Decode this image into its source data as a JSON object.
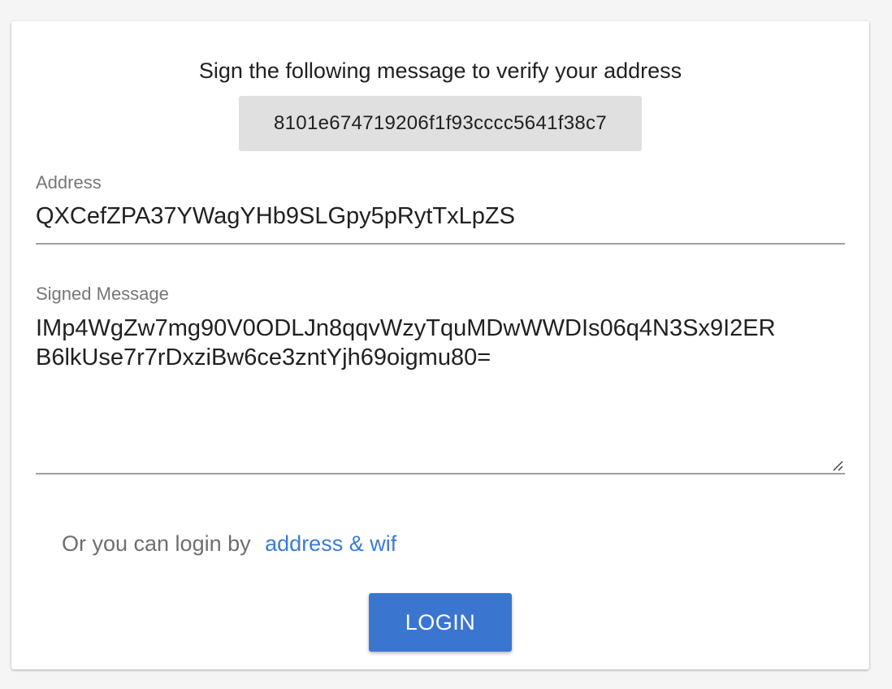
{
  "instruction": "Sign the following message to verify your address",
  "message": "8101e674719206f1f93cccc5641f38c7",
  "address": {
    "label": "Address",
    "value": "QXCefZPA37YWagYHb9SLGpy5pRytTxLpZS"
  },
  "signed_message": {
    "label": "Signed Message",
    "line1": "IMp4WgZw7mg90V0ODLJn8qqvWzyTquMDwWWDIs06q4N3Sx9I2ER",
    "line2": "B6lkUse7r7rDxziBw6ce3zntYjh69oigmu80="
  },
  "alt_login": {
    "prefix": "Or you can login by",
    "link": "address & wif"
  },
  "login_button": "LOGIN",
  "colors": {
    "accent": "#3a76d0",
    "link": "#3a7bd5",
    "chip_background": "#e0e0e0"
  }
}
